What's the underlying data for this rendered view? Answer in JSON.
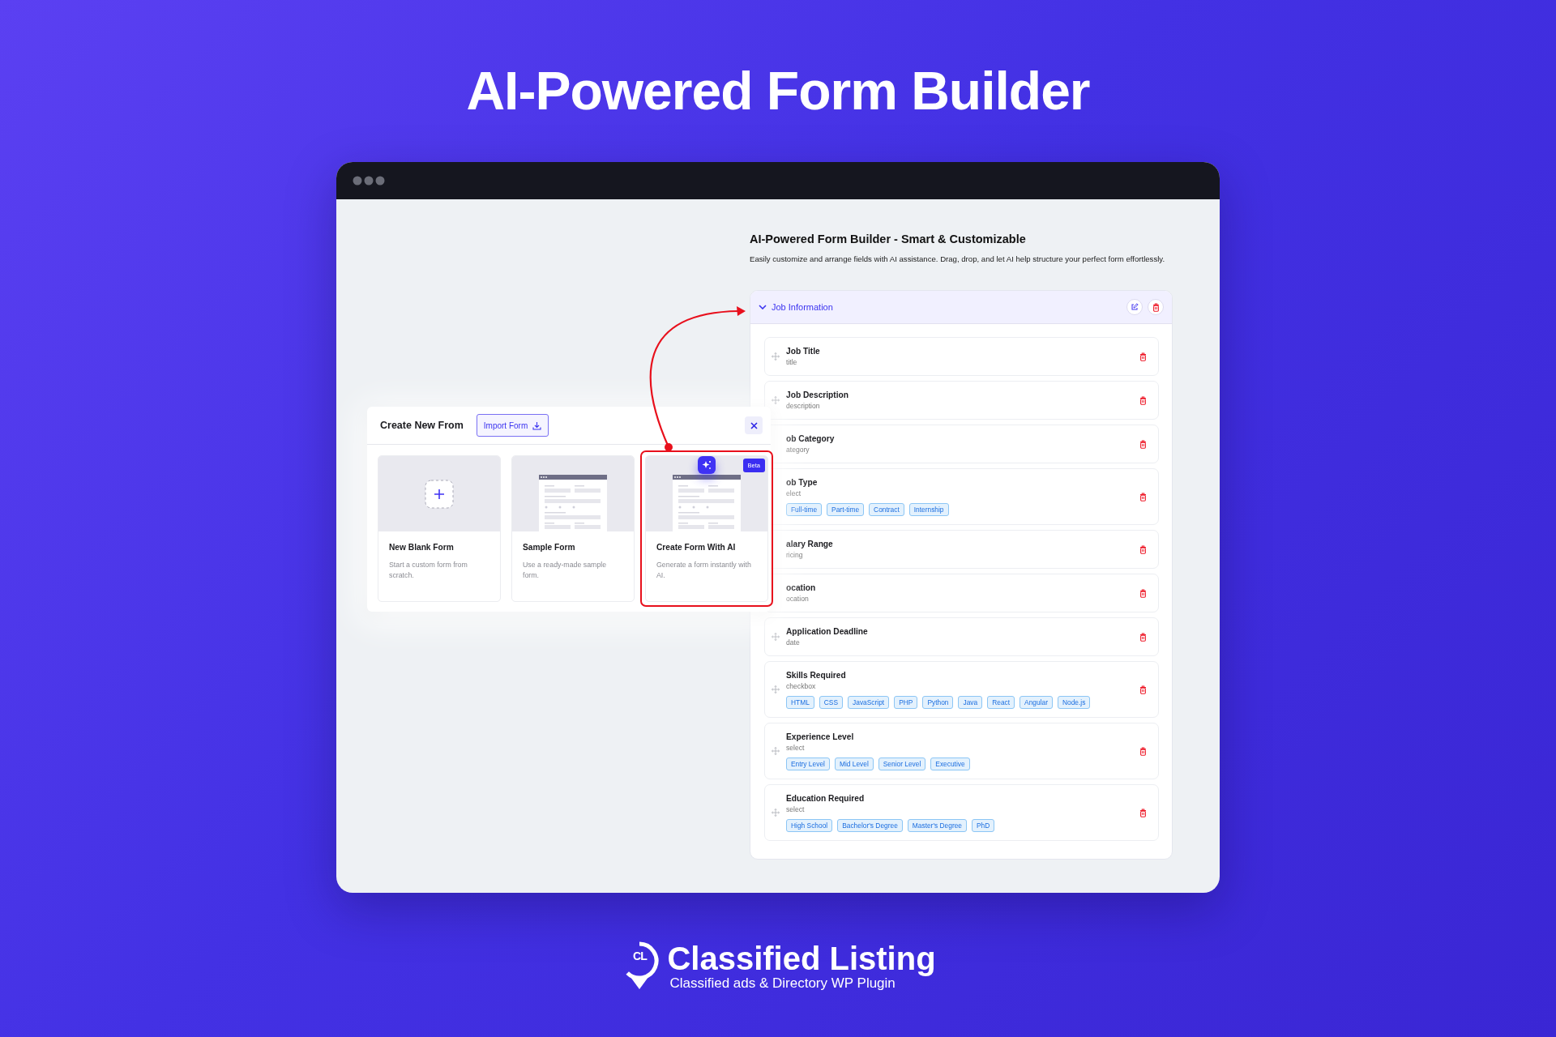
{
  "headline": "AI-Powered Form Builder",
  "builder": {
    "title": "AI-Powered Form Builder - Smart & Customizable",
    "description": "Easily customize and arrange fields with AI assistance. Drag, drop, and let AI help structure your perfect form effortlessly.",
    "section": {
      "title": "Job Information",
      "expanded": true,
      "fields": [
        {
          "label": "Job Title",
          "key": "title",
          "drag_handle": true
        },
        {
          "label": "Job Description",
          "key": "description",
          "drag_handle": true
        },
        {
          "label": "ob Category",
          "key": "ategory",
          "drag_handle": false
        },
        {
          "label": "ob Type",
          "key": "elect",
          "drag_handle": false,
          "options": [
            "Full-time",
            "Part-time",
            "Contract",
            "Internship"
          ]
        },
        {
          "label": "alary Range",
          "key": "ricing",
          "drag_handle": false
        },
        {
          "label": "ocation",
          "key": "ocation",
          "drag_handle": false
        },
        {
          "label": "Application Deadline",
          "key": "date",
          "drag_handle": true
        },
        {
          "label": "Skills Required",
          "key": "checkbox",
          "drag_handle": true,
          "options": [
            "HTML",
            "CSS",
            "JavaScript",
            "PHP",
            "Python",
            "Java",
            "React",
            "Angular",
            "Node.js"
          ]
        },
        {
          "label": "Experience Level",
          "key": "select",
          "drag_handle": true,
          "options": [
            "Entry Level",
            "Mid Level",
            "Senior Level",
            "Executive"
          ]
        },
        {
          "label": "Education Required",
          "key": "select",
          "drag_handle": true,
          "options": [
            "High School",
            "Bachelor's Degree",
            "Master's Degree",
            "PhD"
          ]
        }
      ]
    }
  },
  "modal": {
    "title": "Create New From",
    "import_button": "Import Form",
    "cards": [
      {
        "kind": "blank",
        "title": "New Blank Form",
        "description": "Start a custom form from scratch.",
        "highlighted": false
      },
      {
        "kind": "sample",
        "title": "Sample Form",
        "description": "Use a ready-made sample form.",
        "highlighted": false
      },
      {
        "kind": "ai",
        "title": "Create Form With AI",
        "description": "Generate a form instantly with AI.",
        "highlighted": true,
        "badge": "Beta"
      }
    ]
  },
  "logo": {
    "mark": "CL",
    "name": "Classified Listing",
    "tagline": "Classified ads & Directory WP Plugin"
  }
}
